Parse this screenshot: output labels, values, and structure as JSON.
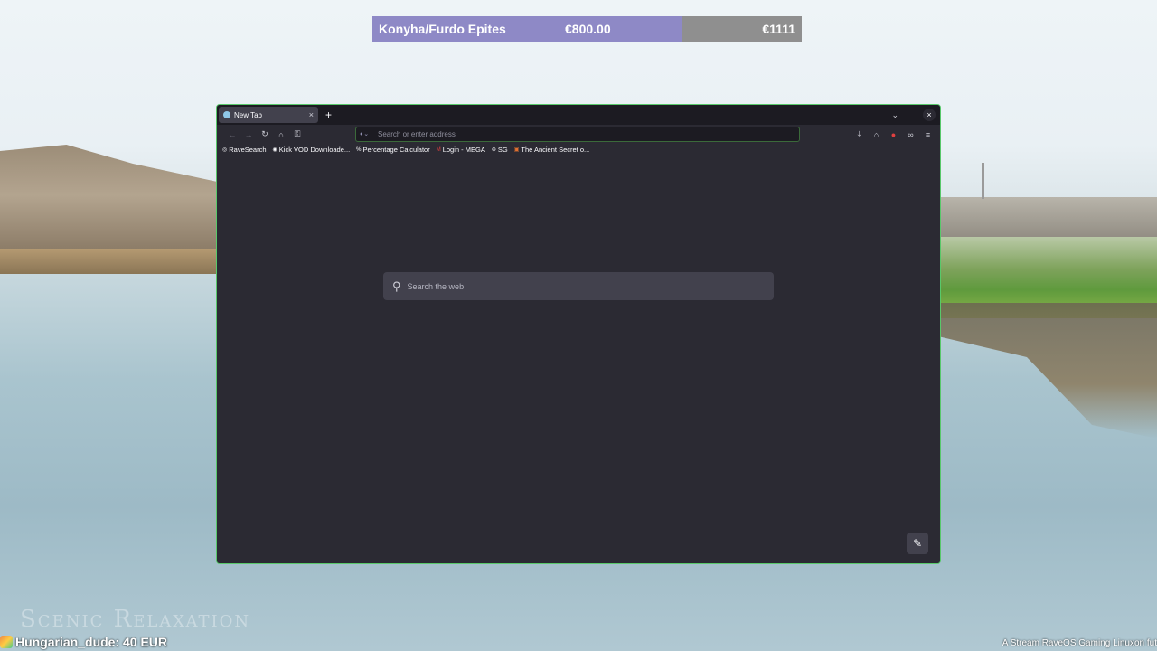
{
  "goal_bar": {
    "label": "Konyha/Furdo Epites",
    "current": "€800.00",
    "total": "€1111",
    "progress_fraction": 0.72
  },
  "browser": {
    "tab": {
      "title": "New Tab",
      "close": "×",
      "favicon": "firefox-icon"
    },
    "new_tab": "+",
    "tab_list": "⌄",
    "window_close": "×",
    "nav": {
      "back": "←",
      "forward": "→",
      "reload": "↻",
      "home": "⌂",
      "passwords": "⚿"
    },
    "urlbar": {
      "placeholder": "Search or enter address",
      "value": ""
    },
    "toolbar_right": [
      "download-icon",
      "extensions-icon",
      "ublock-icon",
      "mask-icon",
      "menu-icon"
    ],
    "bookmarks": [
      {
        "label": "RaveSearch",
        "icon": "◎"
      },
      {
        "label": "Kick VOD Downloade...",
        "icon": "◉"
      },
      {
        "label": "Percentage Calculator",
        "icon": "%"
      },
      {
        "label": "Login - MEGA",
        "icon": "M"
      },
      {
        "label": "SG",
        "icon": "⊕"
      },
      {
        "label": "The Ancient Secret o...",
        "icon": "▣"
      }
    ],
    "search": {
      "placeholder": "Search the web"
    },
    "edit_icon": "✎"
  },
  "overlay": {
    "watermark": "Scenic Relaxation",
    "donor": "Hungarian_dude: 40 EUR",
    "ticker": "A Stream RaveOS Gaming Linuxon fut"
  },
  "colors": {
    "accent_green": "#58c86a",
    "goal_fill": "#8e89c6",
    "browser_bg": "#2b2a33"
  }
}
